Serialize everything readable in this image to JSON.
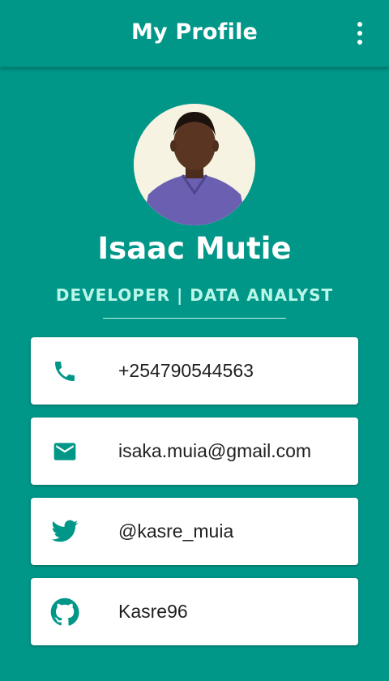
{
  "app_bar": {
    "title": "My Profile",
    "menu_icon": "more-vert-icon"
  },
  "profile": {
    "name": "Isaac Mutie",
    "role": "DEVELOPER | DATA ANALYST",
    "avatar_icon": "profile-photo"
  },
  "contacts": [
    {
      "icon": "phone-icon",
      "value": "+254790544563"
    },
    {
      "icon": "email-icon",
      "value": "isaka.muia@gmail.com"
    },
    {
      "icon": "twitter-icon",
      "value": "@kasre_muia"
    },
    {
      "icon": "github-icon",
      "value": "Kasre96"
    }
  ],
  "colors": {
    "background": "#009688",
    "accent_text": "#b9f6e8",
    "icon": "#009688",
    "card": "#ffffff"
  }
}
